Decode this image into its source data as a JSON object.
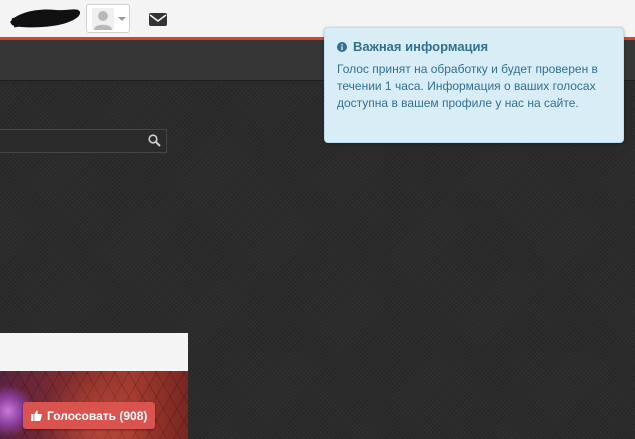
{
  "header": {
    "avatar_icon": "user-avatar-icon",
    "dropdown_icon": "caret-down-icon",
    "mail_icon": "envelope-icon"
  },
  "search": {
    "value": "",
    "icon": "search-icon"
  },
  "card": {
    "vote_icon": "thumbs-up-icon",
    "vote_label": "Голосовать (908)"
  },
  "alert": {
    "icon": "info-circle-icon",
    "title": "Важная информация",
    "text": "Голос принят на обработку и будет проверен в течении 1 часа. Информация о ваших голосах доступна в вашем профиле у нас на сайте."
  },
  "colors": {
    "accent": "#d9452c",
    "vote_button": "#d9534f",
    "alert_bg": "#d9edf7",
    "alert_text": "#31708f"
  }
}
